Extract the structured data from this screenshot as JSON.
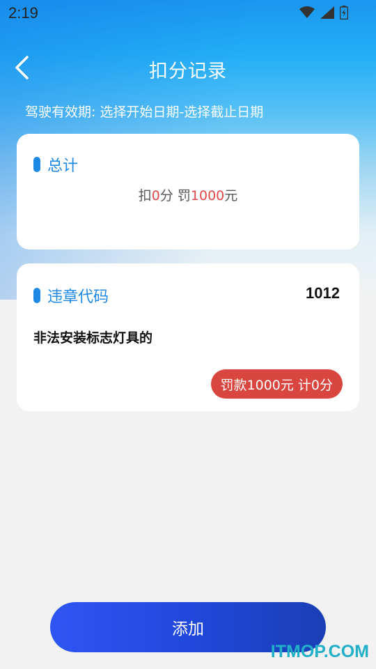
{
  "status_bar": {
    "time": "2:19"
  },
  "header": {
    "title": "扣分记录",
    "validity": "驾驶有效期: 选择开始日期-选择截止日期"
  },
  "total_card": {
    "label": "总计",
    "deduct_prefix": "扣",
    "deduct_points": "0",
    "deduct_unit": "分 罚",
    "fine_amount": "1000",
    "fine_unit": "元"
  },
  "violation_card": {
    "label": "违章代码",
    "code": "1012",
    "description": "非法安装标志灯具的",
    "badge": "罚款1000元 计0分"
  },
  "add_button": {
    "label": "添加"
  },
  "watermark": "ITMOP.COM",
  "colors": {
    "accent": "#1e88e5",
    "red": "#d9453f",
    "button": "#2f55f5"
  }
}
